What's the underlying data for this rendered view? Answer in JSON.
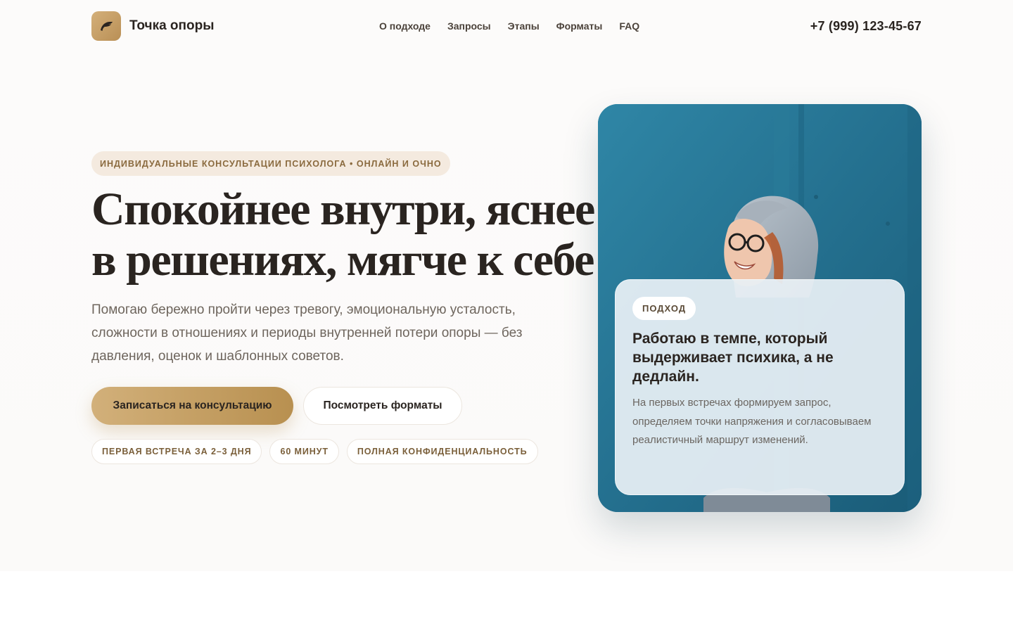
{
  "header": {
    "brand_name": "Точка опоры",
    "logo_icon": "feather-icon",
    "nav": [
      "О подходе",
      "Запросы",
      "Этапы",
      "Форматы",
      "FAQ"
    ],
    "phone": "+7 (999) 123-45-67"
  },
  "hero": {
    "eyebrow": "ИНДИВИДУАЛЬНЫЕ КОНСУЛЬТАЦИИ ПСИХОЛОГА • ОНЛАЙН И ОЧНО",
    "title_line1": "Спокойнее внутри, яснее",
    "title_line2": "в решениях, мягче к себе",
    "text": "Помогаю бережно пройти через тревогу, эмоциональную усталость, сложности в отношениях и периоды внутренней потери опоры — без давления, оценок и шаблонных советов.",
    "primary_button": "Записаться на консультацию",
    "secondary_button": "Посмотреть форматы",
    "chips": [
      "ПЕРВАЯ ВСТРЕЧА ЗА 2–3 ДНЯ",
      "60 МИНУТ",
      "ПОЛНАЯ КОНФИДЕНЦИАЛЬНОСТЬ"
    ]
  },
  "card": {
    "badge": "ПОДХОД",
    "title": "Работаю в темпе, который выдерживает психика, а не дедлайн.",
    "text": "На первых встречах формируем запрос, определяем точки напряжения и согласовываем реалистичный маршрут изменений."
  },
  "colors": {
    "accent_gold": "#c9a46a",
    "text_dark": "#2a2420",
    "photo_blue": "#23708e"
  }
}
